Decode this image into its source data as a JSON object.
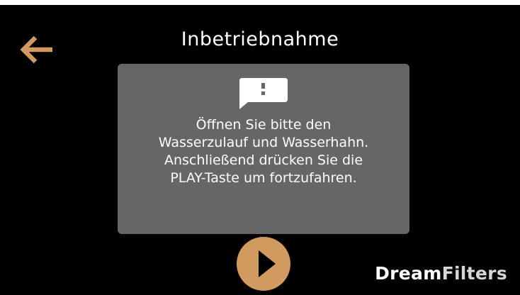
{
  "header": {
    "title": "Inbetriebnahme",
    "back_icon": "arrow-left-icon"
  },
  "dialog": {
    "icon": "speech-bubble-exclamation-icon",
    "message_lines": [
      "Öffnen Sie bitte den",
      "Wasserzulauf und Wasserhahn.",
      "Anschließend drücken Sie die",
      "PLAY-Taste um fortzufahren."
    ]
  },
  "play_button": {
    "icon": "play-icon"
  },
  "brand": {
    "part1": "Dream",
    "part2": "Filters"
  },
  "colors": {
    "background": "#000000",
    "accent": "#d19a5e",
    "dialog": "#666666",
    "text": "#ffffff"
  }
}
